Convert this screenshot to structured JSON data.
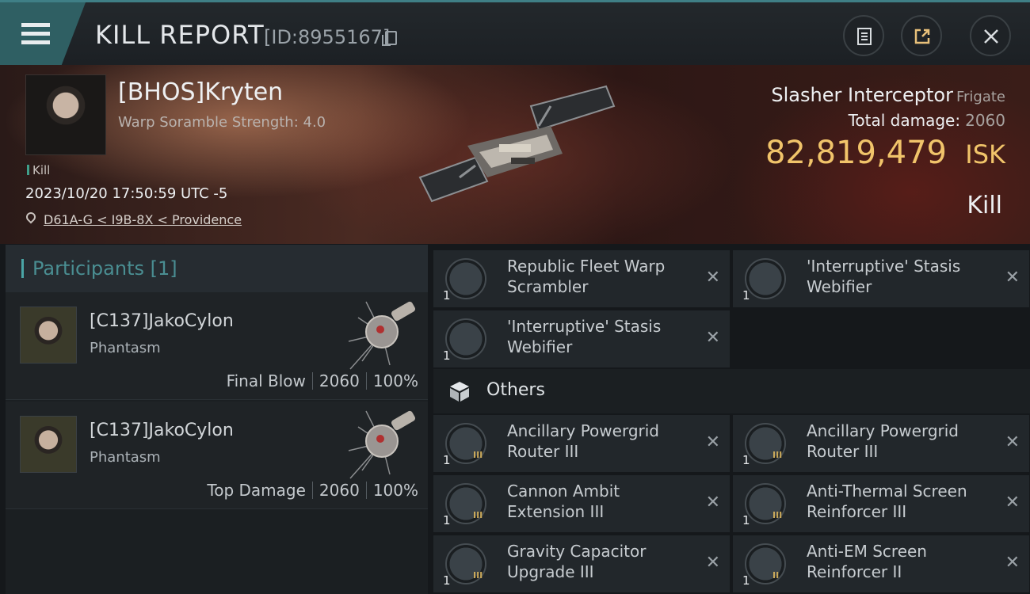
{
  "header": {
    "title": "KILL REPORT",
    "report_id": "[ID:8955167]"
  },
  "victim": {
    "name": "[BHOS]Kryten",
    "stat": "Warp Soramble Strength: 4.0",
    "kill_tag": "Kill",
    "time": "2023/10/20 17:50:59 UTC -5",
    "location": "D61A-G < I9B-8X < Providence",
    "ship_name": "Slasher Interceptor",
    "ship_class": "Frigate",
    "total_damage_label": "Total damage:",
    "total_damage": "2060",
    "isk_value": "82,819,479",
    "isk_unit": "ISK",
    "result": "Kill"
  },
  "participants": {
    "title": "Participants [1]",
    "rows": [
      {
        "name": "[C137]JakoCylon",
        "ship": "Phantasm",
        "role": "Final Blow",
        "damage": "2060",
        "percent": "100%"
      },
      {
        "name": "[C137]JakoCylon",
        "ship": "Phantasm",
        "role": "Top Damage",
        "damage": "2060",
        "percent": "100%"
      }
    ]
  },
  "modules": [
    {
      "name": "Republic Fleet Warp Scrambler",
      "qty": "1",
      "meta": "",
      "icon": "warp-scrambler"
    },
    {
      "name": "'Interruptive' Stasis Webifier",
      "qty": "1",
      "meta": "",
      "icon": "stasis-webifier"
    },
    {
      "name": "'Interruptive' Stasis Webifier",
      "qty": "1",
      "meta": "",
      "icon": "stasis-webifier"
    }
  ],
  "others": {
    "title": "Others",
    "items": [
      {
        "name": "Ancillary Powergrid Router III",
        "qty": "1",
        "meta": "III",
        "icon": "powergrid-router"
      },
      {
        "name": "Ancillary Powergrid Router III",
        "qty": "1",
        "meta": "III",
        "icon": "powergrid-router"
      },
      {
        "name": "Cannon Ambit Extension III",
        "qty": "1",
        "meta": "III",
        "icon": "ambit-extension"
      },
      {
        "name": "Anti-Thermal Screen Reinforcer III",
        "qty": "1",
        "meta": "III",
        "icon": "screen-reinforcer"
      },
      {
        "name": "Gravity Capacitor Upgrade III",
        "qty": "1",
        "meta": "III",
        "icon": "capacitor-upgrade"
      },
      {
        "name": "Anti-EM Screen Reinforcer II",
        "qty": "1",
        "meta": "II",
        "icon": "screen-reinforcer"
      }
    ]
  },
  "close_glyph": "✕",
  "colors": {
    "accent": "#4aa5a6",
    "isk": "#f1c46a",
    "menu": "#2f5f63"
  }
}
